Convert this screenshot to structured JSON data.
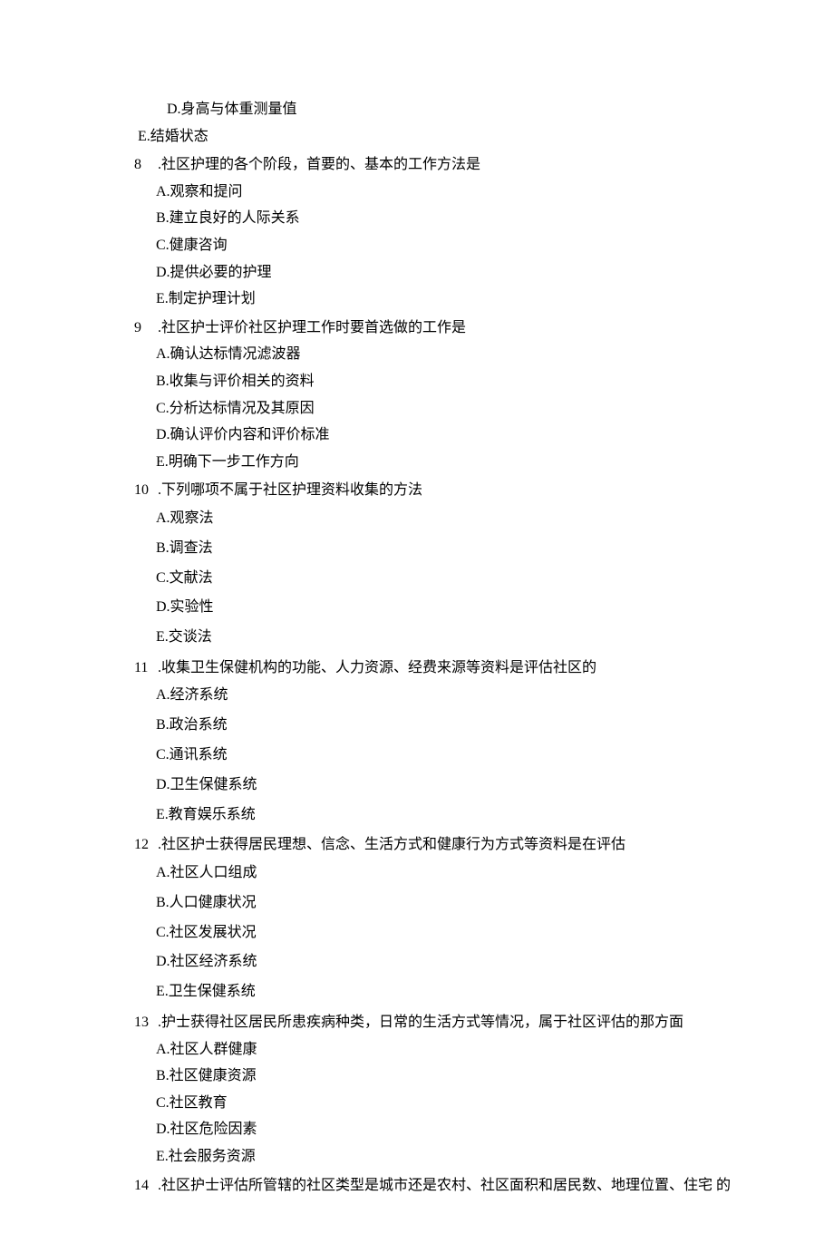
{
  "orphan_option_d": "D.身高与体重测量值",
  "orphan_option_e": "E.结婚状态",
  "questions": [
    {
      "num": "8",
      "stem": ".社区护理的各个阶段，首要的、基本的工作方法是",
      "opts": [
        "A.观察和提问",
        "B.建立良好的人际关系",
        "C.健康咨询",
        "D.提供必要的护理",
        "E.制定护理计划"
      ]
    },
    {
      "num": "9",
      "stem": ".社区护士评价社区护理工作时要首选做的工作是",
      "opts": [
        "A.确认达标情况滤波器",
        "B.收集与评价相关的资料",
        "C.分析达标情况及其原因",
        "D.确认评价内容和评价标准",
        "E.明确下一步工作方向"
      ]
    },
    {
      "num": "10",
      "stem": ".下列哪项不属于社区护理资料收集的方法",
      "opts": [
        "A.观察法",
        "B.调查法",
        "C.文献法",
        "D.实验性",
        "E.交谈法"
      ],
      "spaced": true
    },
    {
      "num": "11",
      "stem": ".收集卫生保健机构的功能、人力资源、经费来源等资料是评估社区的",
      "opts": [
        "A.经济系统",
        "B.政治系统",
        "C.通讯系统",
        "D.卫生保健系统",
        "E.教育娱乐系统"
      ],
      "spaced": true
    },
    {
      "num": "12",
      "stem": ".社区护士获得居民理想、信念、生活方式和健康行为方式等资料是在评估",
      "opts": [
        "A.社区人口组成",
        "B.人口健康状况",
        "C.社区发展状况",
        "D.社区经济系统",
        "E.卫生保健系统"
      ],
      "spaced": true
    },
    {
      "num": "13",
      "stem": ".护士获得社区居民所患疾病种类，日常的生活方式等情况，属于社区评估的那方面",
      "opts": [
        "A.社区人群健康",
        "B.社区健康资源",
        "C.社区教育",
        "D.社区危险因素",
        "E.社会服务资源"
      ]
    },
    {
      "num": "14",
      "stem": ".社区护士评估所管辖的社区类型是城市还是农村、社区面积和居民数、地理位置、住宅 的",
      "opts": []
    }
  ]
}
